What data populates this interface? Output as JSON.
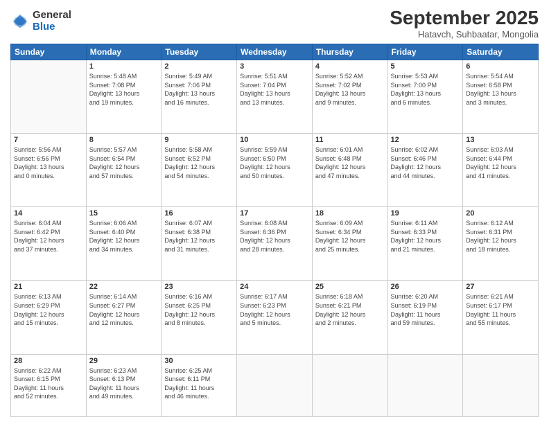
{
  "logo": {
    "general": "General",
    "blue": "Blue"
  },
  "title": "September 2025",
  "location": "Hatavch, Suhbaatar, Mongolia",
  "headers": [
    "Sunday",
    "Monday",
    "Tuesday",
    "Wednesday",
    "Thursday",
    "Friday",
    "Saturday"
  ],
  "weeks": [
    [
      {
        "day": "",
        "info": ""
      },
      {
        "day": "1",
        "info": "Sunrise: 5:48 AM\nSunset: 7:08 PM\nDaylight: 13 hours\nand 19 minutes."
      },
      {
        "day": "2",
        "info": "Sunrise: 5:49 AM\nSunset: 7:06 PM\nDaylight: 13 hours\nand 16 minutes."
      },
      {
        "day": "3",
        "info": "Sunrise: 5:51 AM\nSunset: 7:04 PM\nDaylight: 13 hours\nand 13 minutes."
      },
      {
        "day": "4",
        "info": "Sunrise: 5:52 AM\nSunset: 7:02 PM\nDaylight: 13 hours\nand 9 minutes."
      },
      {
        "day": "5",
        "info": "Sunrise: 5:53 AM\nSunset: 7:00 PM\nDaylight: 13 hours\nand 6 minutes."
      },
      {
        "day": "6",
        "info": "Sunrise: 5:54 AM\nSunset: 6:58 PM\nDaylight: 13 hours\nand 3 minutes."
      }
    ],
    [
      {
        "day": "7",
        "info": "Sunrise: 5:56 AM\nSunset: 6:56 PM\nDaylight: 13 hours\nand 0 minutes."
      },
      {
        "day": "8",
        "info": "Sunrise: 5:57 AM\nSunset: 6:54 PM\nDaylight: 12 hours\nand 57 minutes."
      },
      {
        "day": "9",
        "info": "Sunrise: 5:58 AM\nSunset: 6:52 PM\nDaylight: 12 hours\nand 54 minutes."
      },
      {
        "day": "10",
        "info": "Sunrise: 5:59 AM\nSunset: 6:50 PM\nDaylight: 12 hours\nand 50 minutes."
      },
      {
        "day": "11",
        "info": "Sunrise: 6:01 AM\nSunset: 6:48 PM\nDaylight: 12 hours\nand 47 minutes."
      },
      {
        "day": "12",
        "info": "Sunrise: 6:02 AM\nSunset: 6:46 PM\nDaylight: 12 hours\nand 44 minutes."
      },
      {
        "day": "13",
        "info": "Sunrise: 6:03 AM\nSunset: 6:44 PM\nDaylight: 12 hours\nand 41 minutes."
      }
    ],
    [
      {
        "day": "14",
        "info": "Sunrise: 6:04 AM\nSunset: 6:42 PM\nDaylight: 12 hours\nand 37 minutes."
      },
      {
        "day": "15",
        "info": "Sunrise: 6:06 AM\nSunset: 6:40 PM\nDaylight: 12 hours\nand 34 minutes."
      },
      {
        "day": "16",
        "info": "Sunrise: 6:07 AM\nSunset: 6:38 PM\nDaylight: 12 hours\nand 31 minutes."
      },
      {
        "day": "17",
        "info": "Sunrise: 6:08 AM\nSunset: 6:36 PM\nDaylight: 12 hours\nand 28 minutes."
      },
      {
        "day": "18",
        "info": "Sunrise: 6:09 AM\nSunset: 6:34 PM\nDaylight: 12 hours\nand 25 minutes."
      },
      {
        "day": "19",
        "info": "Sunrise: 6:11 AM\nSunset: 6:33 PM\nDaylight: 12 hours\nand 21 minutes."
      },
      {
        "day": "20",
        "info": "Sunrise: 6:12 AM\nSunset: 6:31 PM\nDaylight: 12 hours\nand 18 minutes."
      }
    ],
    [
      {
        "day": "21",
        "info": "Sunrise: 6:13 AM\nSunset: 6:29 PM\nDaylight: 12 hours\nand 15 minutes."
      },
      {
        "day": "22",
        "info": "Sunrise: 6:14 AM\nSunset: 6:27 PM\nDaylight: 12 hours\nand 12 minutes."
      },
      {
        "day": "23",
        "info": "Sunrise: 6:16 AM\nSunset: 6:25 PM\nDaylight: 12 hours\nand 8 minutes."
      },
      {
        "day": "24",
        "info": "Sunrise: 6:17 AM\nSunset: 6:23 PM\nDaylight: 12 hours\nand 5 minutes."
      },
      {
        "day": "25",
        "info": "Sunrise: 6:18 AM\nSunset: 6:21 PM\nDaylight: 12 hours\nand 2 minutes."
      },
      {
        "day": "26",
        "info": "Sunrise: 6:20 AM\nSunset: 6:19 PM\nDaylight: 11 hours\nand 59 minutes."
      },
      {
        "day": "27",
        "info": "Sunrise: 6:21 AM\nSunset: 6:17 PM\nDaylight: 11 hours\nand 55 minutes."
      }
    ],
    [
      {
        "day": "28",
        "info": "Sunrise: 6:22 AM\nSunset: 6:15 PM\nDaylight: 11 hours\nand 52 minutes."
      },
      {
        "day": "29",
        "info": "Sunrise: 6:23 AM\nSunset: 6:13 PM\nDaylight: 11 hours\nand 49 minutes."
      },
      {
        "day": "30",
        "info": "Sunrise: 6:25 AM\nSunset: 6:11 PM\nDaylight: 11 hours\nand 46 minutes."
      },
      {
        "day": "",
        "info": ""
      },
      {
        "day": "",
        "info": ""
      },
      {
        "day": "",
        "info": ""
      },
      {
        "day": "",
        "info": ""
      }
    ]
  ]
}
